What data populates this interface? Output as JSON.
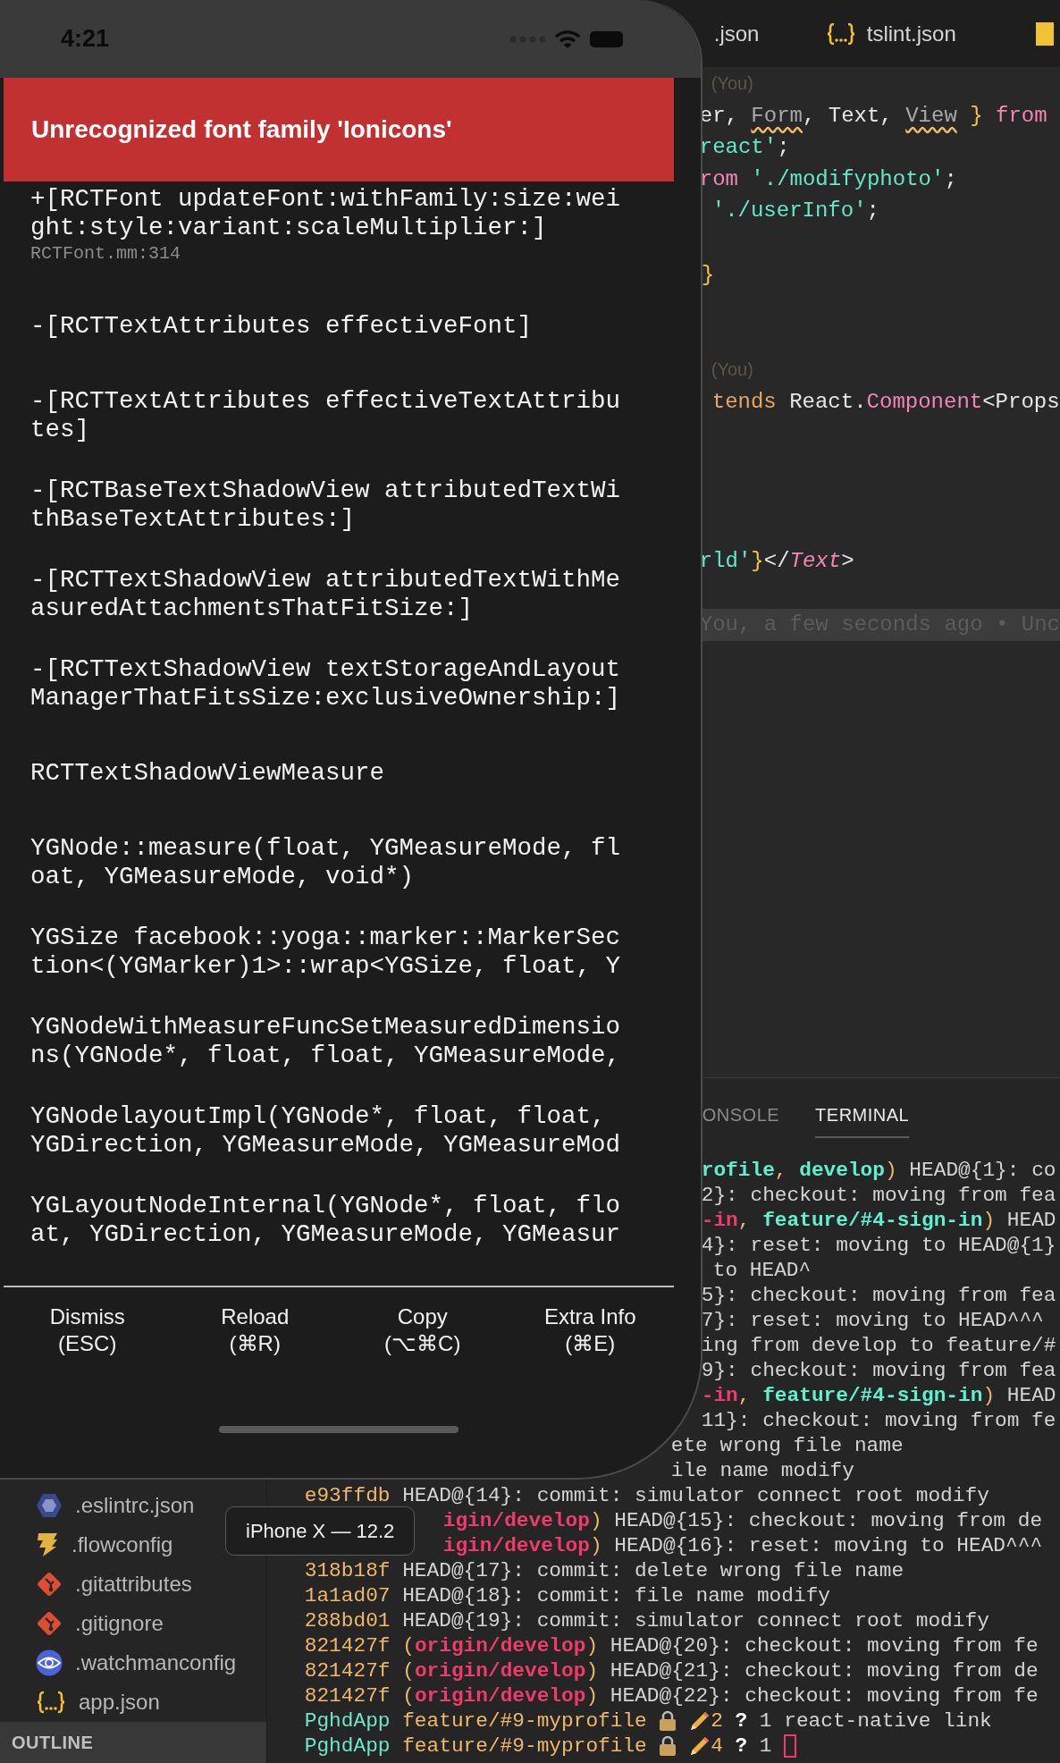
{
  "simulator": {
    "status_bar": {
      "time": "4:21"
    },
    "error_title": "Unrecognized font family 'Ionicons'",
    "stack_frames": [
      {
        "method": "+[RCTFont updateFont:withFamily:size:weight:style:variant:scaleMultiplier:]",
        "file": "RCTFont.mm:314"
      },
      {
        "method": "-[RCTTextAttributes effectiveFont]"
      },
      {
        "method": "-[RCTTextAttributes effectiveTextAttributes]"
      },
      {
        "method": "-[RCTBaseTextShadowView attributedTextWithBaseTextAttributes:]"
      },
      {
        "method": "-[RCTTextShadowView attributedTextWithMeasuredAttachmentsThatFitSize:]"
      },
      {
        "method": "-[RCTTextShadowView textStorageAndLayoutManagerThatFitsSize:exclusiveOwnership:]"
      },
      {
        "method": "RCTTextShadowViewMeasure"
      },
      {
        "method": "YGNode::measure(float, YGMeasureMode, float, YGMeasureMode, void*)"
      },
      {
        "method": "YGSize facebook::yoga::marker::MarkerSection<(YGMarker)1>::wrap<YGSize, float, Y"
      },
      {
        "method": "YGNodeWithMeasureFuncSetMeasuredDimensions(YGNode*, float, float, YGMeasureMode,"
      },
      {
        "method": "YGNodelayoutImpl(YGNode*, float, float, YGDirection, YGMeasureMode, YGMeasureMod"
      },
      {
        "method": "YGLayoutNodeInternal(YGNode*, float, float, YGDirection, YGMeasureMode, YGMeasur"
      }
    ],
    "buttons": [
      {
        "label": "Dismiss",
        "shortcut": "(ESC)"
      },
      {
        "label": "Reload",
        "shortcut": "(⌘R)"
      },
      {
        "label": "Copy",
        "shortcut": "(⌥⌘C)"
      },
      {
        "label": "Extra Info",
        "shortcut": "(⌘E)"
      }
    ],
    "device_label": "iPhone X — 12.2"
  },
  "editor": {
    "tabs": [
      {
        "label": ".json"
      },
      {
        "label": "tslint.json",
        "kind": "json"
      },
      {
        "kind": "js"
      }
    ],
    "lines": [
      {
        "highlighted": false,
        "segments": [
          {
            "text": "(You)",
            "kind": "codelens"
          }
        ]
      },
      {
        "highlighted": false,
        "segments": [
          {
            "text": "er, ",
            "kind": "plain"
          },
          {
            "text": "Form",
            "kind": "warning"
          },
          {
            "text": ", Text, ",
            "kind": "plain"
          },
          {
            "text": "View",
            "kind": "warning"
          },
          {
            "text": " }",
            "kind": "brace"
          },
          {
            "text": " from",
            "kind": "keyword"
          }
        ]
      },
      {
        "highlighted": false,
        "segments": [
          {
            "text": "react'",
            "kind": "string"
          },
          {
            "text": ";",
            "kind": "plain"
          }
        ]
      },
      {
        "highlighted": false,
        "segments": [
          {
            "text": "rom ",
            "kind": "keyword"
          },
          {
            "text": "'./modifyphoto'",
            "kind": "string"
          },
          {
            "text": ";",
            "kind": "plain"
          }
        ]
      },
      {
        "highlighted": false,
        "segments": [
          {
            "text": "'./userInfo'",
            "kind": "string"
          },
          {
            "text": ";",
            "kind": "plain"
          }
        ]
      },
      {
        "highlighted": false,
        "segments": [
          {
            "text": "}",
            "kind": "brace"
          }
        ]
      },
      {
        "highlighted": false,
        "segments": [
          {
            "text": "(You)",
            "kind": "codelens"
          }
        ]
      },
      {
        "highlighted": false,
        "segments": [
          {
            "text": "tends",
            "kind": "storage"
          },
          {
            "text": " React.",
            "kind": "plain"
          },
          {
            "text": "Component",
            "kind": "keyword"
          },
          {
            "text": "<Props",
            "kind": "plain"
          }
        ]
      },
      {
        "highlighted": false,
        "segments": [
          {
            "text": "rld'",
            "kind": "string"
          },
          {
            "text": "}",
            "kind": "brace"
          },
          {
            "text": "</",
            "kind": "plain"
          },
          {
            "text": "Text",
            "kind": "tag"
          },
          {
            "text": ">",
            "kind": "plain"
          }
        ]
      },
      {
        "highlighted": true,
        "segments": [
          {
            "text": "You, a few seconds ago • Unc",
            "kind": "blame"
          }
        ]
      }
    ]
  },
  "panel": {
    "tabs": [
      {
        "label": "ONSOLE",
        "selected": false
      },
      {
        "label": "TERMINAL",
        "selected": true
      }
    ],
    "terminal_lines": [
      {
        "segments": [
          {
            "text": "rofile",
            "kind": "local"
          },
          {
            "text": ", ",
            "kind": "punct"
          },
          {
            "text": "develop",
            "kind": "local"
          },
          {
            "text": ")",
            "kind": "punct"
          },
          {
            "text": " HEAD@{1}: co",
            "kind": "plain"
          }
        ]
      },
      {
        "segments": [
          {
            "text": "2}: checkout: moving from fea",
            "kind": "plain"
          }
        ]
      },
      {
        "segments": [
          {
            "text": "-in",
            "kind": "remote"
          },
          {
            "text": ", ",
            "kind": "punct"
          },
          {
            "text": "feature/#4-sign-in",
            "kind": "local"
          },
          {
            "text": ")",
            "kind": "punct"
          },
          {
            "text": " HEAD",
            "kind": "plain"
          }
        ]
      },
      {
        "segments": [
          {
            "text": "4}: reset: moving to HEAD@{1}",
            "kind": "plain"
          }
        ]
      },
      {
        "segments": [
          {
            "text": "to HEAD^",
            "kind": "plain"
          }
        ]
      },
      {
        "segments": [
          {
            "text": "5}: checkout: moving from fea",
            "kind": "plain"
          }
        ]
      },
      {
        "segments": [
          {
            "text": "7}: reset: moving to HEAD^^^",
            "kind": "plain"
          }
        ]
      },
      {
        "segments": [
          {
            "text": "ing from develop to feature/#",
            "kind": "plain"
          }
        ]
      },
      {
        "segments": [
          {
            "text": "9}: checkout: moving from fea",
            "kind": "plain"
          }
        ]
      },
      {
        "segments": [
          {
            "text": "-in",
            "kind": "remote"
          },
          {
            "text": ", ",
            "kind": "punct"
          },
          {
            "text": "feature/#4-sign-in",
            "kind": "local"
          },
          {
            "text": ")",
            "kind": "punct"
          },
          {
            "text": " HEAD",
            "kind": "plain"
          }
        ]
      },
      {
        "segments": [
          {
            "text": "11}: checkout: moving from fe",
            "kind": "plain"
          }
        ]
      },
      {
        "segments": [
          {
            "text": "ete wrong file name",
            "kind": "plain"
          }
        ]
      },
      {
        "segments": [
          {
            "text": "ile name modify",
            "kind": "plain"
          }
        ]
      },
      {
        "segments": [
          {
            "text": "e93ffdb",
            "kind": "hash"
          },
          {
            "text": " HEAD@{14}: commit: simulator connect root modify",
            "kind": "plain"
          }
        ]
      },
      {
        "segments": [
          {
            "text": "igin/develop",
            "kind": "remote"
          },
          {
            "text": ")",
            "kind": "punct"
          },
          {
            "text": " HEAD@{15}: checkout: moving from de",
            "kind": "plain"
          }
        ]
      },
      {
        "segments": [
          {
            "text": "igin/develop",
            "kind": "remote"
          },
          {
            "text": ")",
            "kind": "punct"
          },
          {
            "text": " HEAD@{16}: reset: moving to HEAD^^^",
            "kind": "plain"
          }
        ]
      },
      {
        "segments": [
          {
            "text": "318b18f",
            "kind": "hash"
          },
          {
            "text": " HEAD@{17}: commit: delete wrong file name",
            "kind": "plain"
          }
        ]
      },
      {
        "segments": [
          {
            "text": "1a1ad07",
            "kind": "hash"
          },
          {
            "text": " HEAD@{18}: commit: file name modify",
            "kind": "plain"
          }
        ]
      },
      {
        "segments": [
          {
            "text": "288bd01",
            "kind": "hash"
          },
          {
            "text": " HEAD@{19}: commit: simulator connect root modify",
            "kind": "plain"
          }
        ]
      },
      {
        "segments": [
          {
            "text": "821427f",
            "kind": "hash"
          },
          {
            "text": " (",
            "kind": "punct"
          },
          {
            "text": "origin/develop",
            "kind": "remote"
          },
          {
            "text": ")",
            "kind": "punct"
          },
          {
            "text": " HEAD@{20}: checkout: moving from fe",
            "kind": "plain"
          }
        ]
      },
      {
        "segments": [
          {
            "text": "821427f",
            "kind": "hash"
          },
          {
            "text": " (",
            "kind": "punct"
          },
          {
            "text": "origin/develop",
            "kind": "remote"
          },
          {
            "text": ")",
            "kind": "punct"
          },
          {
            "text": " HEAD@{21}: checkout: moving from de",
            "kind": "plain"
          }
        ]
      },
      {
        "segments": [
          {
            "text": "821427f",
            "kind": "hash"
          },
          {
            "text": " (",
            "kind": "punct"
          },
          {
            "text": "origin/develop",
            "kind": "remote"
          },
          {
            "text": ")",
            "kind": "punct"
          },
          {
            "text": " HEAD@{22}: checkout: moving from fe",
            "kind": "plain"
          }
        ]
      },
      {
        "segments": [
          {
            "text": "PghdApp",
            "kind": "dir"
          },
          {
            "text": "feature/#9-myprofile",
            "kind": "branch"
          },
          {
            "kind": "lock"
          },
          {
            "kind": "pencil"
          },
          {
            "text": "2",
            "kind": "count"
          },
          {
            "text": "?",
            "kind": "question"
          },
          {
            "text": "1 react-native link",
            "kind": "plain"
          }
        ]
      },
      {
        "segments": [
          {
            "text": "PghdApp",
            "kind": "dir"
          },
          {
            "text": "feature/#9-myprofile",
            "kind": "branch"
          },
          {
            "kind": "lock"
          },
          {
            "kind": "pencil"
          },
          {
            "text": "4",
            "kind": "count"
          },
          {
            "text": "?",
            "kind": "question"
          },
          {
            "text": "1",
            "kind": "plain"
          },
          {
            "kind": "cursor"
          }
        ]
      }
    ]
  },
  "sidebar": {
    "files": [
      {
        "name": ".eslintrc.json",
        "kind": "eslint"
      },
      {
        "name": ".flowconfig",
        "kind": "flow"
      },
      {
        "name": ".gitattributes",
        "kind": "git"
      },
      {
        "name": ".gitignore",
        "kind": "git"
      },
      {
        "name": ".watchmanconfig",
        "kind": "watchman"
      },
      {
        "name": "app.json",
        "kind": "json"
      }
    ],
    "sections": [
      {
        "label": "OUTLINE"
      }
    ]
  }
}
